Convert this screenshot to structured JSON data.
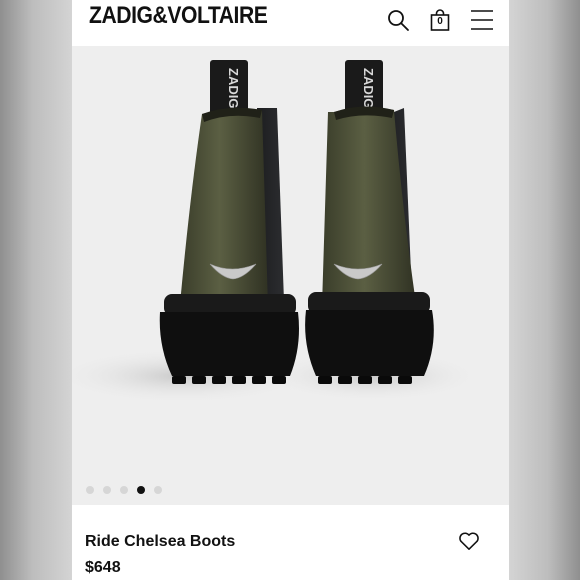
{
  "brand": {
    "logo_text": "ZADIG&VOLTAIRE"
  },
  "header": {
    "icons": [
      "search-icon",
      "shopping-bag-icon",
      "hamburger-menu-icon"
    ],
    "bag_count": "0"
  },
  "gallery": {
    "image": "khaki-leather-chelsea-boots-back-view",
    "pull_tab_text": "ZADIG",
    "dots_count": 5,
    "active_dot": 4
  },
  "product": {
    "name": "Ride Chelsea Boots",
    "price": "$648"
  },
  "colors": {
    "boot_leather": "#4a4d35",
    "sole": "#111111",
    "background": "#eeeeee"
  }
}
